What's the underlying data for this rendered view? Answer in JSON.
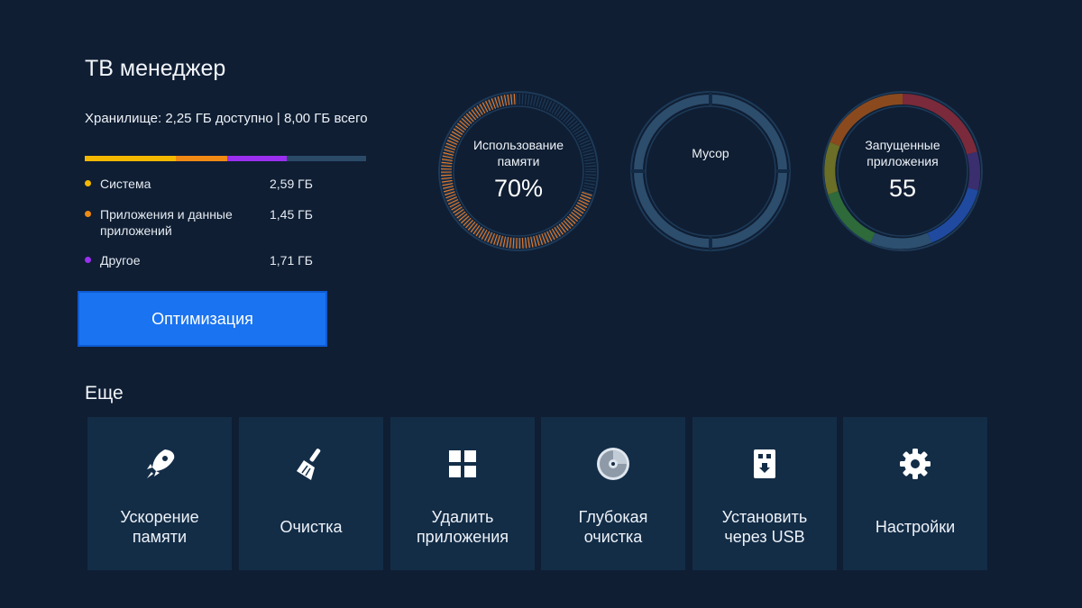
{
  "app": {
    "title": "ТВ менеджер"
  },
  "storage": {
    "summary": "Хранилище: 2,25 ГБ доступно | 8,00 ГБ всего",
    "total_gb": 8.0,
    "available_gb": 2.25,
    "bar_track_color": "#2a4a68",
    "items": [
      {
        "label": "Система",
        "value": "2,59 ГБ",
        "gb": 2.59,
        "color": "#f5b800"
      },
      {
        "label": "Приложения и данные приложений",
        "value": "1,45 ГБ",
        "gb": 1.45,
        "color": "#f08a14"
      },
      {
        "label": "Другое",
        "value": "1,71 ГБ",
        "gb": 1.71,
        "color": "#9b2ff0"
      }
    ]
  },
  "actions": {
    "optimize_label": "Оптимизация"
  },
  "gauges": {
    "memory": {
      "label": "Использование памяти",
      "value": "70%",
      "fraction": 0.7,
      "color": "#e07a2e"
    },
    "junk": {
      "label": "Мусор",
      "value": ""
    },
    "running": {
      "label": "Запущенные приложения",
      "value": "55"
    }
  },
  "more": {
    "title": "Еще",
    "tiles": [
      {
        "label": "Ускорение\nпамяти",
        "icon": "rocket-icon"
      },
      {
        "label": "Очистка",
        "icon": "broom-icon"
      },
      {
        "label": "Удалить\nприложения",
        "icon": "apps-grid-icon"
      },
      {
        "label": "Глубокая\nочистка",
        "icon": "disc-icon"
      },
      {
        "label": "Установить\nчерез USB",
        "icon": "usb-install-icon"
      },
      {
        "label": "Настройки",
        "icon": "gear-icon"
      }
    ]
  },
  "colors": {
    "background": "#0f1e33",
    "tile": "#132d47",
    "accent": "#1a73f0"
  }
}
